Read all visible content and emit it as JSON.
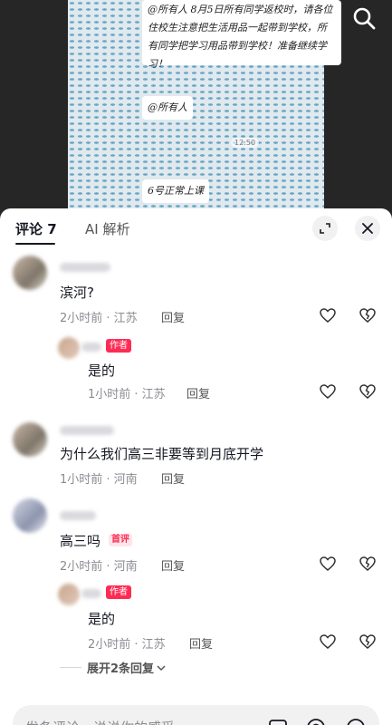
{
  "video": {
    "chat_message": "@所有人 8月5日所有同学返校时，请各位住校生注意把生活用品一起带到学校，所有同学把学习用品带到学校！准备继续学习！",
    "at_all": "@所有人",
    "timestamp": "12:50",
    "day6_message": "6号正常上课"
  },
  "tabs": {
    "comments_label": "评论 7",
    "ai_label": "AI 解析"
  },
  "comments": [
    {
      "text": "滨河?",
      "meta": "2小时前 · 江苏",
      "reply": "回复"
    },
    {
      "text": "是的",
      "meta": "1小时前 · 江苏",
      "reply": "回复",
      "tag": "作者"
    },
    {
      "text": "为什么我们高三非要等到月底开学",
      "meta": "1小时前 · 河南",
      "reply": "回复"
    },
    {
      "text": "高三吗",
      "meta": "2小时前 · 河南",
      "reply": "回复",
      "tag": "首评"
    },
    {
      "text": "是的",
      "meta": "2小时前 · 江苏",
      "reply": "回复",
      "tag": "作者"
    }
  ],
  "expand_replies": "展开2条回复",
  "input": {
    "placeholder": "发条评论，说说你的感受"
  },
  "colors": {
    "accent": "#fe2c55",
    "text": "#161823",
    "meta": "#8a8b91"
  },
  "icons": [
    "search-icon",
    "expand-icon",
    "close-icon",
    "like-icon",
    "dislike-icon",
    "chevron-down-icon",
    "image-icon",
    "at-icon",
    "emoji-icon"
  ]
}
